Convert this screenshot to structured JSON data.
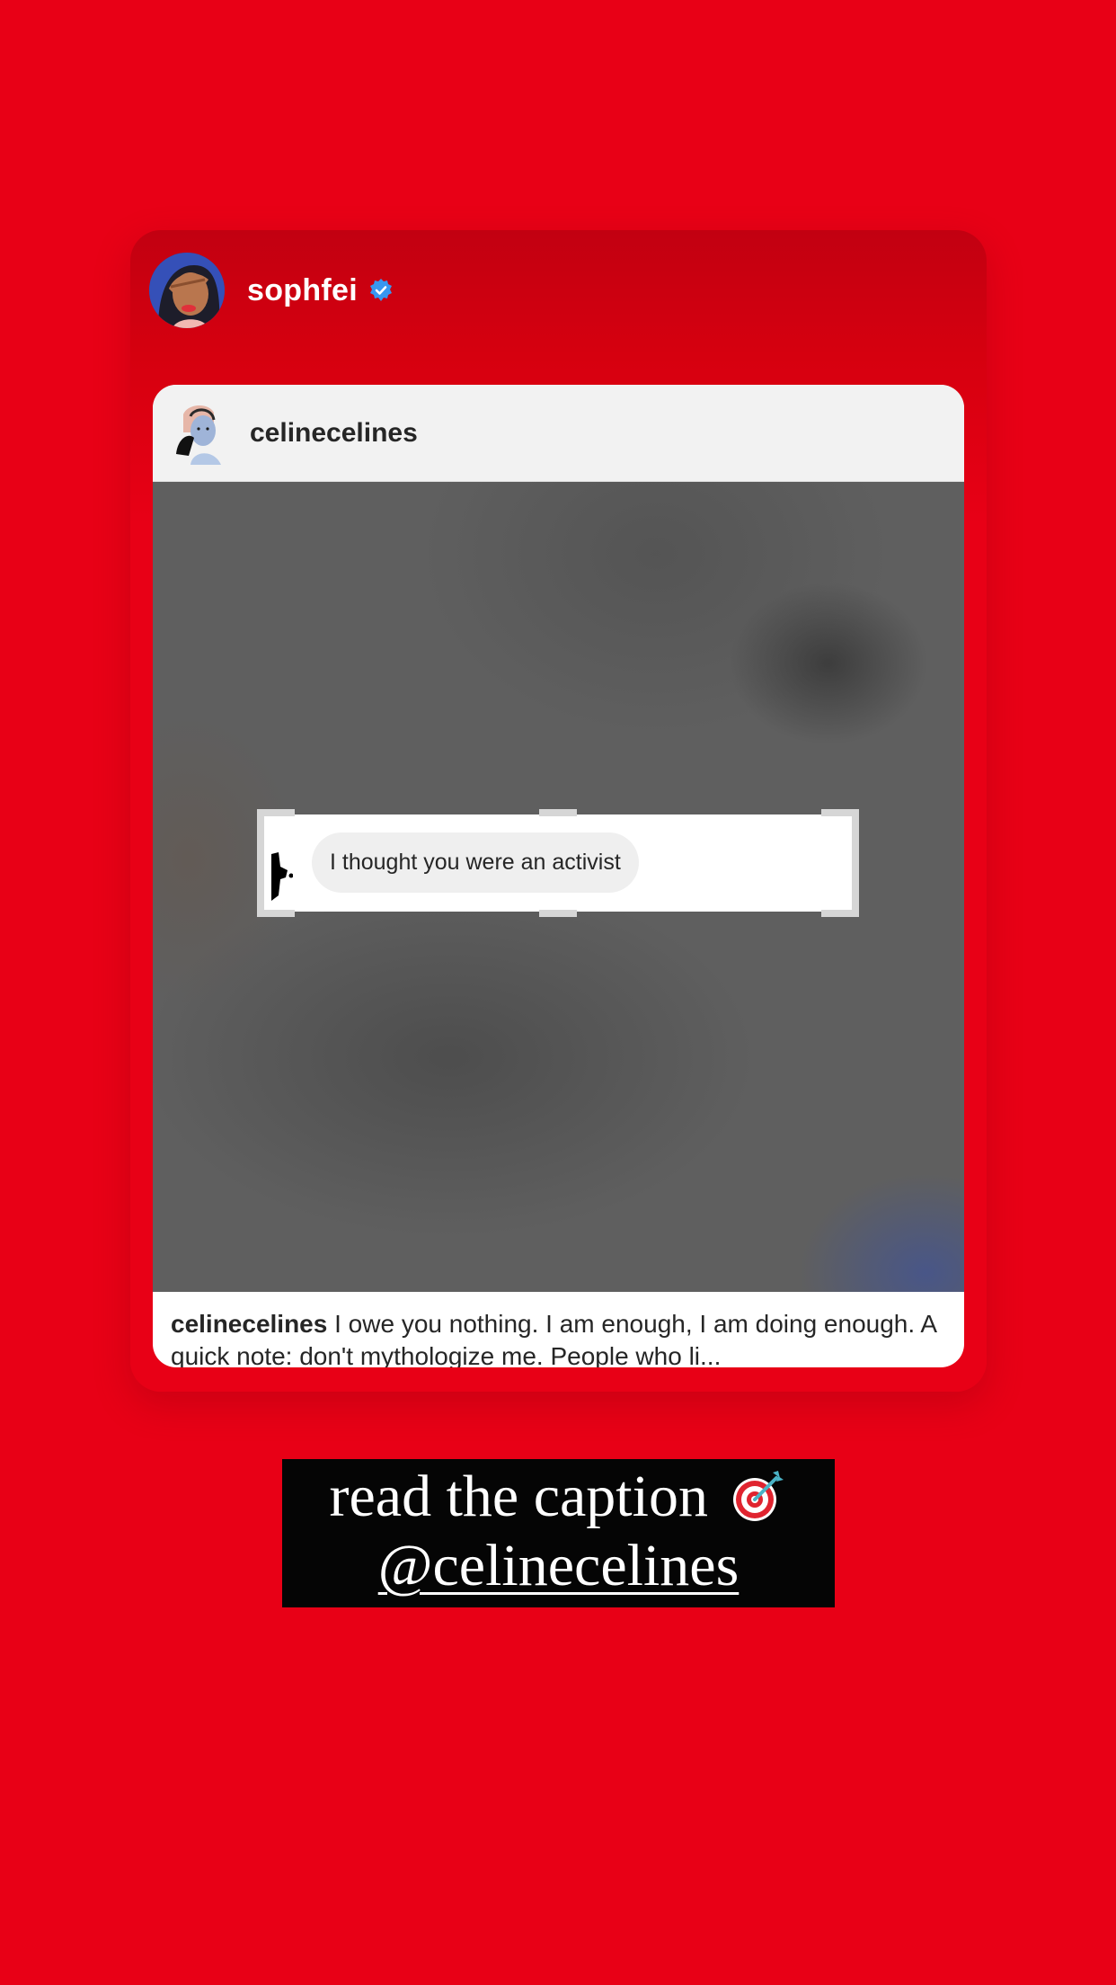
{
  "story": {
    "author": {
      "username": "sophfei",
      "verified": true,
      "avatar_icon": "illustrated-avatar-icon",
      "verified_icon": "verified-badge-icon"
    },
    "background_color": "#e80016"
  },
  "shared_post": {
    "username": "celinecelines",
    "avatar_icon": "illustrated-avatar-icon",
    "media": {
      "message_text": "I thought you were an activist"
    },
    "caption": {
      "username": "celinecelines",
      "text": "I owe you nothing. I am enough, I am doing enough. A quick note: don't mythologize me.  People who li..."
    }
  },
  "sticker": {
    "line1": "read the caption",
    "line1_icon": "target-dart-icon",
    "mention": "@celinecelines"
  }
}
